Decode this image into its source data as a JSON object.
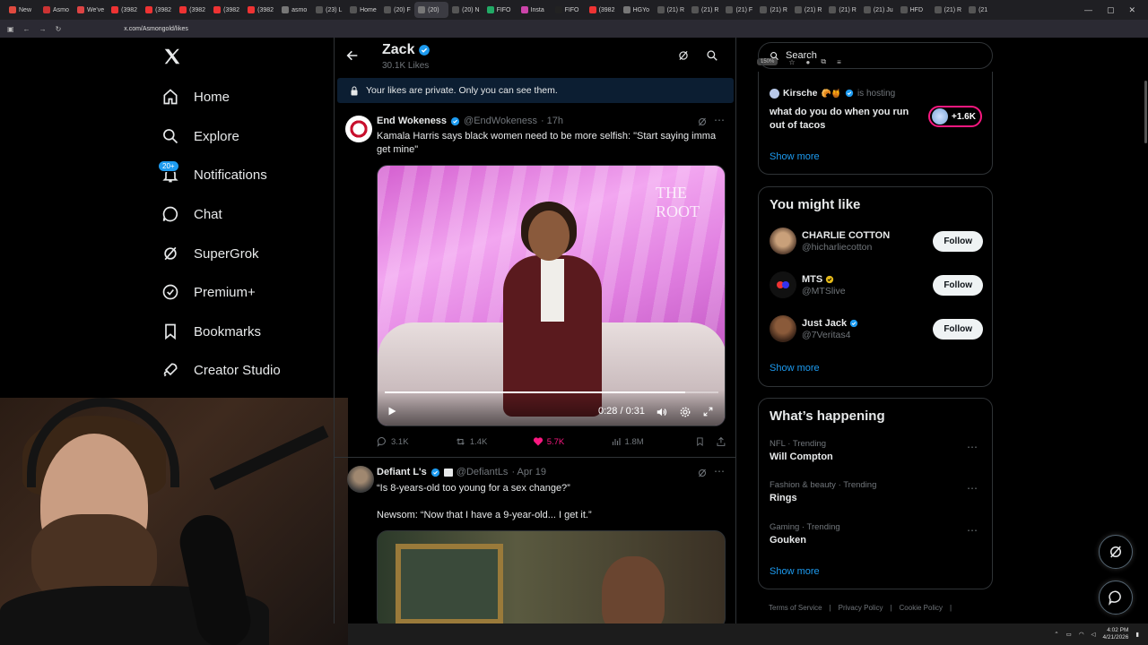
{
  "browser": {
    "tabs": [
      "New",
      "Asmo",
      "We've",
      "(3982",
      "(3982",
      "(3982",
      "(3982",
      "(3982",
      "asmo",
      "(23) L",
      "Home",
      "(20) F",
      "(20)",
      "(20) N",
      "FIFO",
      "Insta",
      "FIFO",
      "(3982",
      "HGYo",
      "(21) R",
      "(21) R",
      "(21) F",
      "(21) R",
      "(21) R",
      "(21) R",
      "(21) Ju",
      "HFD",
      "(21) R",
      "(21"
    ],
    "url": "x.com/Asmongold/likes",
    "zoom": "150%"
  },
  "nav": {
    "home": "Home",
    "explore": "Explore",
    "notifications": "Notifications",
    "notifications_badge": "20+",
    "chat": "Chat",
    "supergrok": "SuperGrok",
    "premium": "Premium+",
    "bookmarks": "Bookmarks",
    "creator_studio": "Creator Studio"
  },
  "profile_header": {
    "name": "Zack",
    "likes": "30.1K Likes"
  },
  "private_notice": "Your likes are private. Only you can see them.",
  "tweet1": {
    "name": "End Wokeness",
    "handle": "@EndWokeness",
    "time": "· 17h",
    "text": "Kamala Harris says black women need to be more selfish: \"Start saying imma get mine\"",
    "video_logo": "THE ROOT",
    "video_time": "0:28 / 0:31",
    "video_progress": 0.9,
    "replies": "3.1K",
    "reposts": "1.4K",
    "likes": "5.7K",
    "views": "1.8M"
  },
  "tweet2": {
    "name": "Defiant L's",
    "handle": "@DefiantLs",
    "time": "· Apr 19",
    "text1": "“Is 8-years-old too young for a sex change?”",
    "text2": "Newsom: “Now that I have a 9-year-old... I get it.”"
  },
  "search": {
    "placeholder": "Search"
  },
  "space": {
    "host": "Kirsche",
    "hosting": "is hosting",
    "question": "what do you do when you run out of tacos",
    "listeners": "+1.6K",
    "show_more": "Show more"
  },
  "you_might_like": {
    "title": "You might like",
    "users": [
      {
        "name": "CHARLIE COTTON",
        "handle": "@hicharliecotton",
        "follow": "Follow"
      },
      {
        "name": "MTS",
        "handle": "@MTSlive",
        "follow": "Follow"
      },
      {
        "name": "Just Jack",
        "handle": "@7Veritas4",
        "follow": "Follow"
      }
    ],
    "show_more": "Show more"
  },
  "whats_happening": {
    "title": "What’s happening",
    "trends": [
      {
        "category": "NFL · Trending",
        "topic": "Will Compton"
      },
      {
        "category": "Fashion & beauty · Trending",
        "topic": "Rings"
      },
      {
        "category": "Gaming · Trending",
        "topic": "Gouken"
      }
    ],
    "show_more": "Show more"
  },
  "footer": {
    "terms": "Terms of Service",
    "privacy": "Privacy Policy",
    "cookie": "Cookie Policy"
  },
  "taskbar": {
    "time": "4:02 PM",
    "date": "4/21/2026"
  },
  "colors": {
    "accent": "#1d9bf0",
    "like": "#f91880",
    "background": "#000000",
    "border": "#2f3336"
  }
}
